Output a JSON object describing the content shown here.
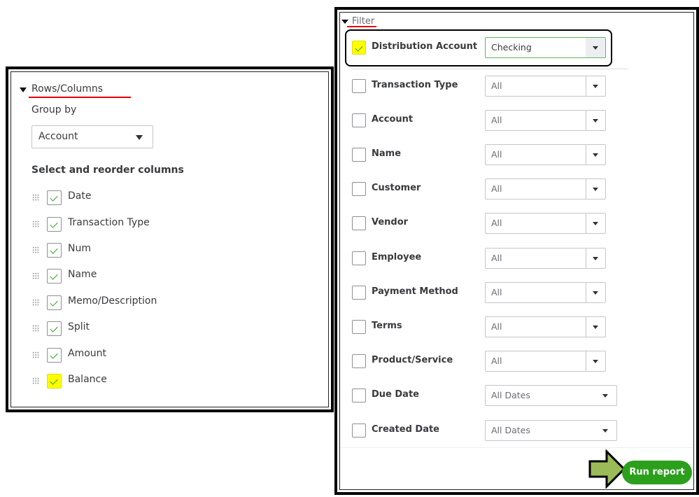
{
  "rows_columns": {
    "title": "Rows/Columns",
    "group_by_label": "Group by",
    "group_by_value": "Account",
    "columns_heading": "Select and reorder columns",
    "columns": [
      {
        "label": "Date",
        "checked": true
      },
      {
        "label": "Transaction Type",
        "checked": true
      },
      {
        "label": "Num",
        "checked": true
      },
      {
        "label": "Name",
        "checked": true
      },
      {
        "label": "Memo/Description",
        "checked": true
      },
      {
        "label": "Split",
        "checked": true
      },
      {
        "label": "Amount",
        "checked": true
      },
      {
        "label": "Balance",
        "checked": true,
        "highlighted": true
      }
    ]
  },
  "filter": {
    "title": "Filter",
    "items": [
      {
        "label": "Distribution Account",
        "checked": true,
        "value": "Checking",
        "highlighted": true
      },
      {
        "label": "Transaction Type",
        "checked": false,
        "value": "All"
      },
      {
        "label": "Account",
        "checked": false,
        "value": "All"
      },
      {
        "label": "Name",
        "checked": false,
        "value": "All"
      },
      {
        "label": "Customer",
        "checked": false,
        "value": "All"
      },
      {
        "label": "Vendor",
        "checked": false,
        "value": "All"
      },
      {
        "label": "Employee",
        "checked": false,
        "value": "All"
      },
      {
        "label": "Payment Method",
        "checked": false,
        "value": "All"
      },
      {
        "label": "Terms",
        "checked": false,
        "value": "All"
      },
      {
        "label": "Product/Service",
        "checked": false,
        "value": "All"
      },
      {
        "label": "Due Date",
        "checked": false,
        "value": "All Dates",
        "date": true
      },
      {
        "label": "Created Date",
        "checked": false,
        "value": "All Dates",
        "date": true
      }
    ]
  },
  "run_report_label": "Run report",
  "colors": {
    "accent": "#2ca01c",
    "highlight": "#ffff00",
    "annotation_arrow": "#9bbb59",
    "annotation_underline": "#ee0000"
  }
}
